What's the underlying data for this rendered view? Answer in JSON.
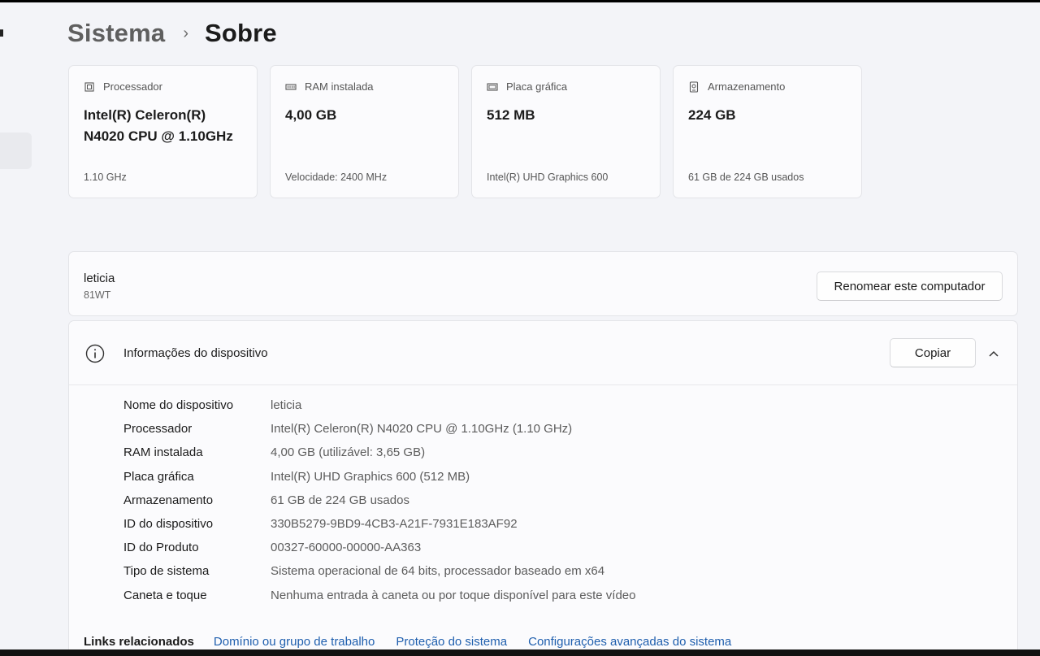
{
  "breadcrumb": {
    "parent": "Sistema",
    "separator": "›",
    "current": "Sobre"
  },
  "cards": [
    {
      "icon": "processor-icon",
      "label": "Processador",
      "value": "Intel(R) Celeron(R) N4020 CPU @ 1.10GHz",
      "sub": "1.10 GHz"
    },
    {
      "icon": "ram-icon",
      "label": "RAM instalada",
      "value": "4,00 GB",
      "sub": "Velocidade: 2400 MHz"
    },
    {
      "icon": "graphics-card-icon",
      "label": "Placa gráfica",
      "value": "512 MB",
      "sub": "Intel(R) UHD Graphics 600"
    },
    {
      "icon": "storage-icon",
      "label": "Armazenamento",
      "value": "224 GB",
      "sub": "61 GB de 224 GB usados"
    }
  ],
  "computer": {
    "name": "leticia",
    "model": "81WT",
    "rename_label": "Renomear este computador"
  },
  "device_info": {
    "title": "Informações do dispositivo",
    "copy_label": "Copiar",
    "rows": [
      {
        "key": "Nome do dispositivo",
        "value": "leticia"
      },
      {
        "key": "Processador",
        "value": "Intel(R) Celeron(R) N4020 CPU @ 1.10GHz (1.10 GHz)"
      },
      {
        "key": "RAM instalada",
        "value": "4,00 GB (utilizável: 3,65 GB)"
      },
      {
        "key": "Placa gráfica",
        "value": "Intel(R) UHD Graphics 600 (512 MB)"
      },
      {
        "key": "Armazenamento",
        "value": "61 GB de 224 GB usados"
      },
      {
        "key": "ID do dispositivo",
        "value": "330B5279-9BD9-4CB3-A21F-7931E183AF92"
      },
      {
        "key": "ID do Produto",
        "value": "00327-60000-00000-AA363"
      },
      {
        "key": "Tipo de sistema",
        "value": "Sistema operacional de 64 bits, processador baseado em x64"
      },
      {
        "key": "Caneta e toque",
        "value": "Nenhuma entrada à caneta ou por toque disponível para este vídeo"
      }
    ]
  },
  "related": {
    "title": "Links relacionados",
    "links": [
      "Domínio ou grupo de trabalho",
      "Proteção do sistema",
      "Configurações avançadas do sistema"
    ]
  },
  "colors": {
    "link": "#1f5fae",
    "background": "#f3f4f8",
    "card": "#fbfbfd"
  }
}
